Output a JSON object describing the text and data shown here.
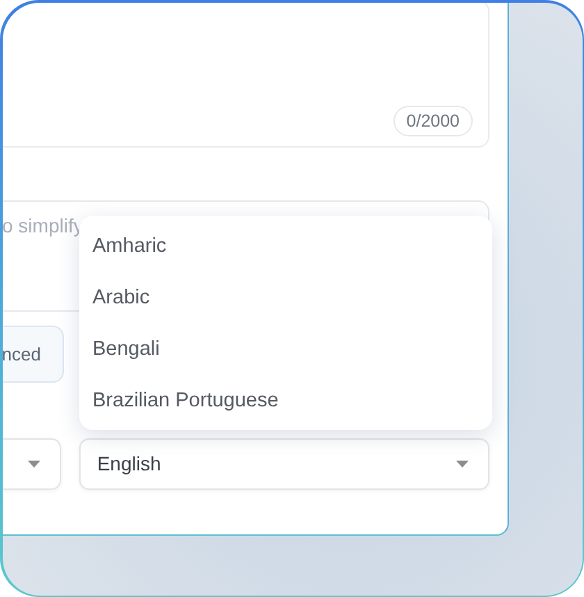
{
  "text_input": {
    "counter": "0/2000"
  },
  "prompt_input": {
    "placeholder": "o simplify"
  },
  "mode_button": {
    "label": "nced"
  },
  "target_select": {
    "value": "English",
    "expanded": true,
    "options": [
      {
        "label": "Amharic"
      },
      {
        "label": "Arabic"
      },
      {
        "label": "Bengali"
      },
      {
        "label": "Brazilian Portuguese"
      }
    ]
  }
}
